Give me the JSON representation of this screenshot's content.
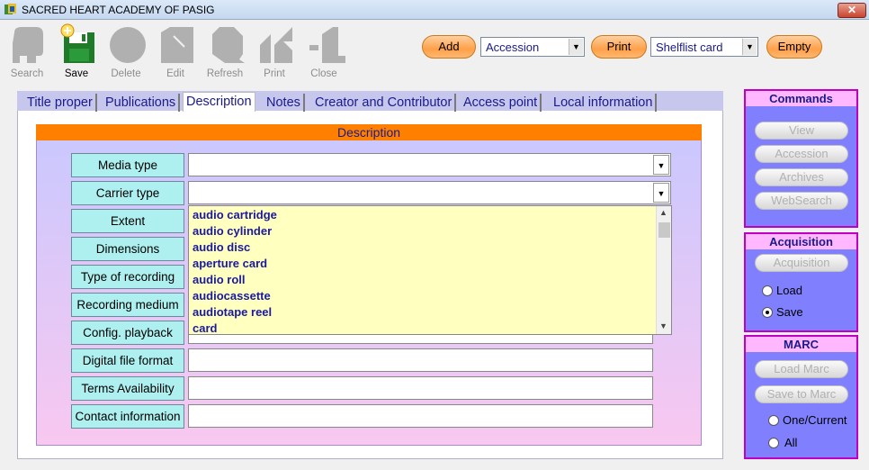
{
  "window": {
    "title": "SACRED HEART ACADEMY OF PASIG",
    "close_label": "✕"
  },
  "toolbar": {
    "search": "Search",
    "save": "Save",
    "delete": "Delete",
    "edit": "Edit",
    "refresh": "Refresh",
    "print": "Print",
    "close": "Close"
  },
  "actions": {
    "add_label": "Add",
    "accession_value": "Accession",
    "print_label": "Print",
    "report_value": "Shelflist card",
    "empty_label": "Empty"
  },
  "tabs": [
    {
      "label": "Title proper"
    },
    {
      "label": "Publications"
    },
    {
      "label": "Description"
    },
    {
      "label": "Notes"
    },
    {
      "label": "Creator and Contributor"
    },
    {
      "label": "Access point"
    },
    {
      "label": "Local information"
    }
  ],
  "description": {
    "header": "Description",
    "fields": [
      {
        "label": "Media type",
        "value": ""
      },
      {
        "label": "Carrier type",
        "value": ""
      },
      {
        "label": "Extent",
        "value": ""
      },
      {
        "label": "Dimensions",
        "value": ""
      },
      {
        "label": "Type of recording",
        "value": ""
      },
      {
        "label": "Recording medium",
        "value": ""
      },
      {
        "label": "Config.  playback",
        "value": ""
      },
      {
        "label": "Digital file format",
        "value": ""
      },
      {
        "label": "Terms Availability",
        "value": ""
      },
      {
        "label": "Contact information",
        "value": ""
      }
    ],
    "carrier_options": [
      "audio cartridge",
      "audio cylinder",
      "audio disc",
      "aperture card",
      "audio roll",
      "audiocassette",
      "audiotape reel",
      "card"
    ]
  },
  "commands": {
    "header": "Commands",
    "buttons": [
      "View",
      "Accession",
      "Archives",
      "WebSearch"
    ]
  },
  "acquisition": {
    "header": "Acquisition",
    "button": "Acquisition",
    "options": [
      "Load",
      "Save"
    ],
    "selected": "Save"
  },
  "marc": {
    "header": "MARC",
    "buttons": [
      "Load Marc",
      "Save to Marc"
    ],
    "options": [
      "One/Current",
      "All"
    ]
  },
  "colors": {
    "accent_orange": "#ff8000",
    "sidebar_bg": "#8080ff",
    "sidebar_border": "#c000c0",
    "label_bg": "#aef0f0"
  }
}
